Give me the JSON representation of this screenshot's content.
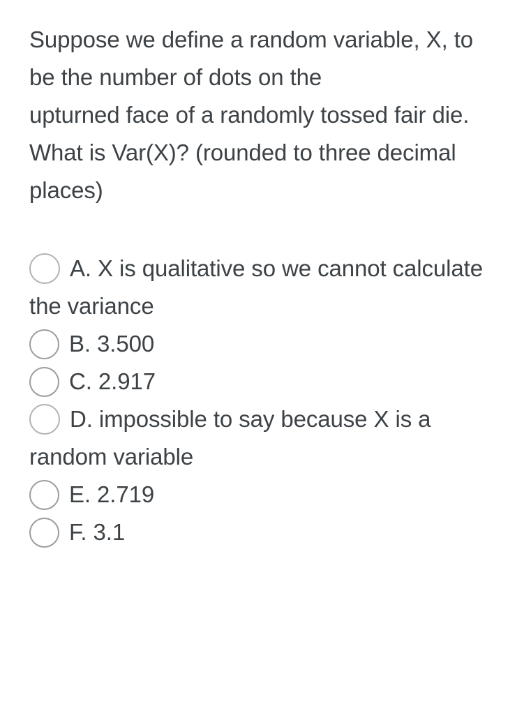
{
  "question": {
    "lines": [
      "Suppose we define a random variable, X, to be the number of dots on the",
      "upturned face of a randomly tossed fair die. What is Var(X)? (rounded to three decimal places)"
    ]
  },
  "options": [
    {
      "id": "A",
      "label": "A. X is qualitative so we cannot calculate the variance",
      "selected": false,
      "radio_icon": "radio-unchecked-icon"
    },
    {
      "id": "B",
      "label": "B. 3.500",
      "selected": false,
      "radio_icon": "radio-unchecked-icon"
    },
    {
      "id": "C",
      "label": "C. 2.917",
      "selected": false,
      "radio_icon": "radio-unchecked-icon"
    },
    {
      "id": "D",
      "label": "D. impossible to say because X is a random variable",
      "selected": false,
      "radio_icon": "radio-unchecked-icon"
    },
    {
      "id": "E",
      "label": "E. 2.719",
      "selected": false,
      "radio_icon": "radio-unchecked-icon"
    },
    {
      "id": "F",
      "label": "F. 3.1",
      "selected": false,
      "radio_icon": "radio-unchecked-icon"
    }
  ],
  "colors": {
    "background": "#ffffff",
    "text": "#3d4246",
    "radio_border": "#9d9d9d",
    "radio_border_light": "#b2b2b2"
  }
}
